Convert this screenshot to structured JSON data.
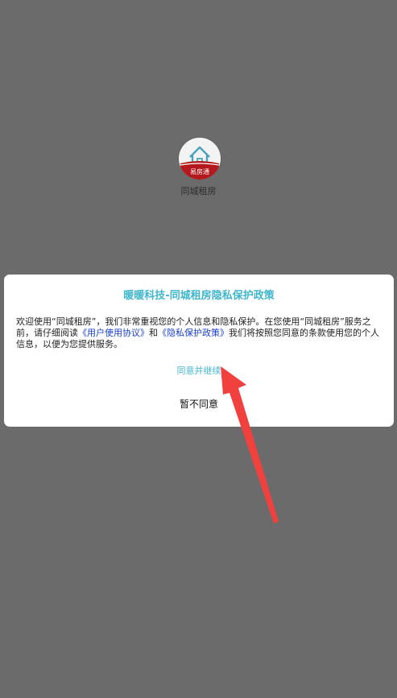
{
  "splash": {
    "app_name": "同城租房",
    "logo_text": "易房通",
    "logo_icon": "house-icon"
  },
  "dialog": {
    "title": "暖暖科技-同城租房隐私保护政策",
    "body": {
      "intro": "欢迎使用“同城租房”，我们非常重视您的个人信息和隐私保护。在您使用“同城租房”服务之前，请仔细阅读",
      "user_agreement_link": "《用户使用协议》",
      "and": "和",
      "privacy_policy_link": "《隐私保护政策》",
      "outro": "我们将按照您同意的条款使用您的个人信息，以便为您提供服务。"
    },
    "agree_label": "同意并继续",
    "disagree_label": "暂不同意"
  },
  "annotation": {
    "arrow_color": "#f0413f"
  },
  "colors": {
    "overlay": "#6b6b6b",
    "accent": "#3fb6cc",
    "link": "#1a40c8"
  }
}
